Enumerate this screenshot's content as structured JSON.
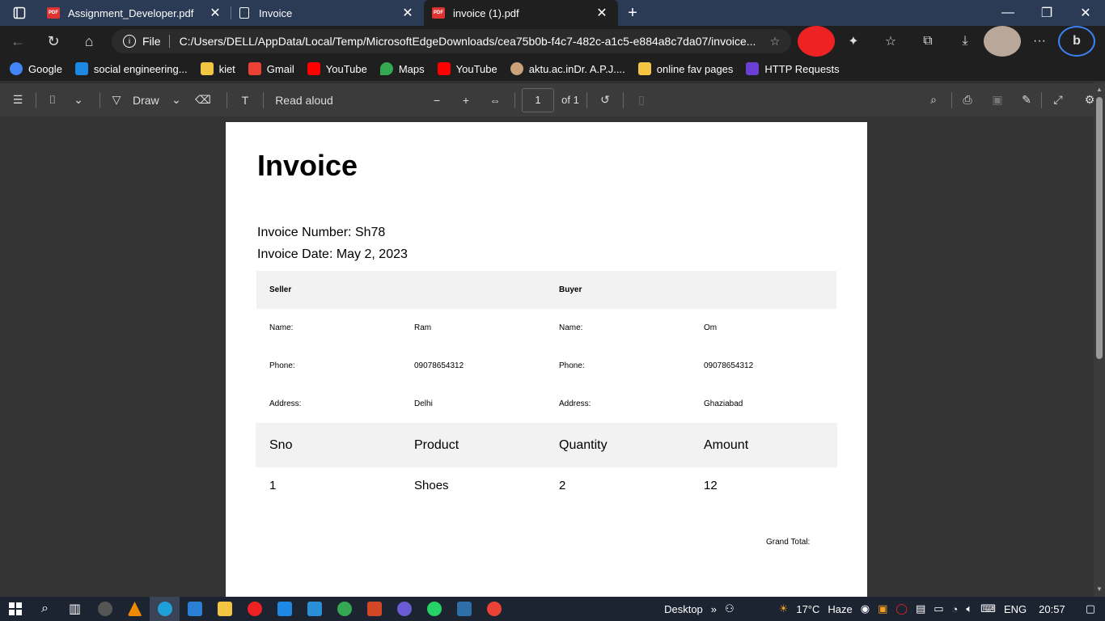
{
  "tabs": [
    {
      "label": "Assignment_Developer.pdf",
      "icon": "pdf-icon"
    },
    {
      "label": "Invoice",
      "icon": "document-icon"
    },
    {
      "label": "invoice (1).pdf",
      "icon": "pdf-icon",
      "active": true
    }
  ],
  "address": {
    "scheme_label": "File",
    "url": "C:/Users/DELL/AppData/Local/Temp/MicrosoftEdgeDownloads/cea75b0b-f4c7-482c-a1c5-e884a8c7da07/invoice..."
  },
  "favorites": [
    {
      "label": "Google",
      "color": "#4285f4"
    },
    {
      "label": "social engineering...",
      "color": "#1e88e5"
    },
    {
      "label": "kiet",
      "color": "#f4c542"
    },
    {
      "label": "Gmail",
      "color": "#ea4335"
    },
    {
      "label": "YouTube",
      "color": "#ff0000"
    },
    {
      "label": "Maps",
      "color": "#34a853"
    },
    {
      "label": "YouTube",
      "color": "#ff0000"
    },
    {
      "label": "aktu.ac.inDr. A.P.J....",
      "color": "#c9a27a"
    },
    {
      "label": "online fav pages",
      "color": "#f4c542"
    },
    {
      "label": "HTTP Requests",
      "color": "#6b3fd4"
    }
  ],
  "pdf_toolbar": {
    "draw_label": "Draw",
    "read_aloud_label": "Read aloud",
    "page_number": "1",
    "page_total": "of 1"
  },
  "invoice": {
    "title": "Invoice",
    "number_line": "Invoice Number: Sh78",
    "date_line": "Invoice Date: May 2, 2023",
    "seller_header": "Seller",
    "buyer_header": "Buyer",
    "rows": [
      {
        "seller_key": "Name:",
        "seller_val": "Ram",
        "buyer_key": "Name:",
        "buyer_val": "Om"
      },
      {
        "seller_key": "Phone:",
        "seller_val": "09078654312",
        "buyer_key": "Phone:",
        "buyer_val": "09078654312"
      },
      {
        "seller_key": "Address:",
        "seller_val": "Delhi",
        "buyer_key": "Address:",
        "buyer_val": "Ghaziabad"
      }
    ],
    "item_headers": [
      "Sno",
      "Product",
      "Quantity",
      "Amount"
    ],
    "items": [
      {
        "sno": "1",
        "product": "Shoes",
        "quantity": "2",
        "amount": "12"
      }
    ],
    "grand_total_label": "Grand Total:"
  },
  "taskbar": {
    "desktop_label": "Desktop",
    "temperature": "17°C",
    "weather": "Haze",
    "language": "ENG",
    "time": "20:57"
  }
}
